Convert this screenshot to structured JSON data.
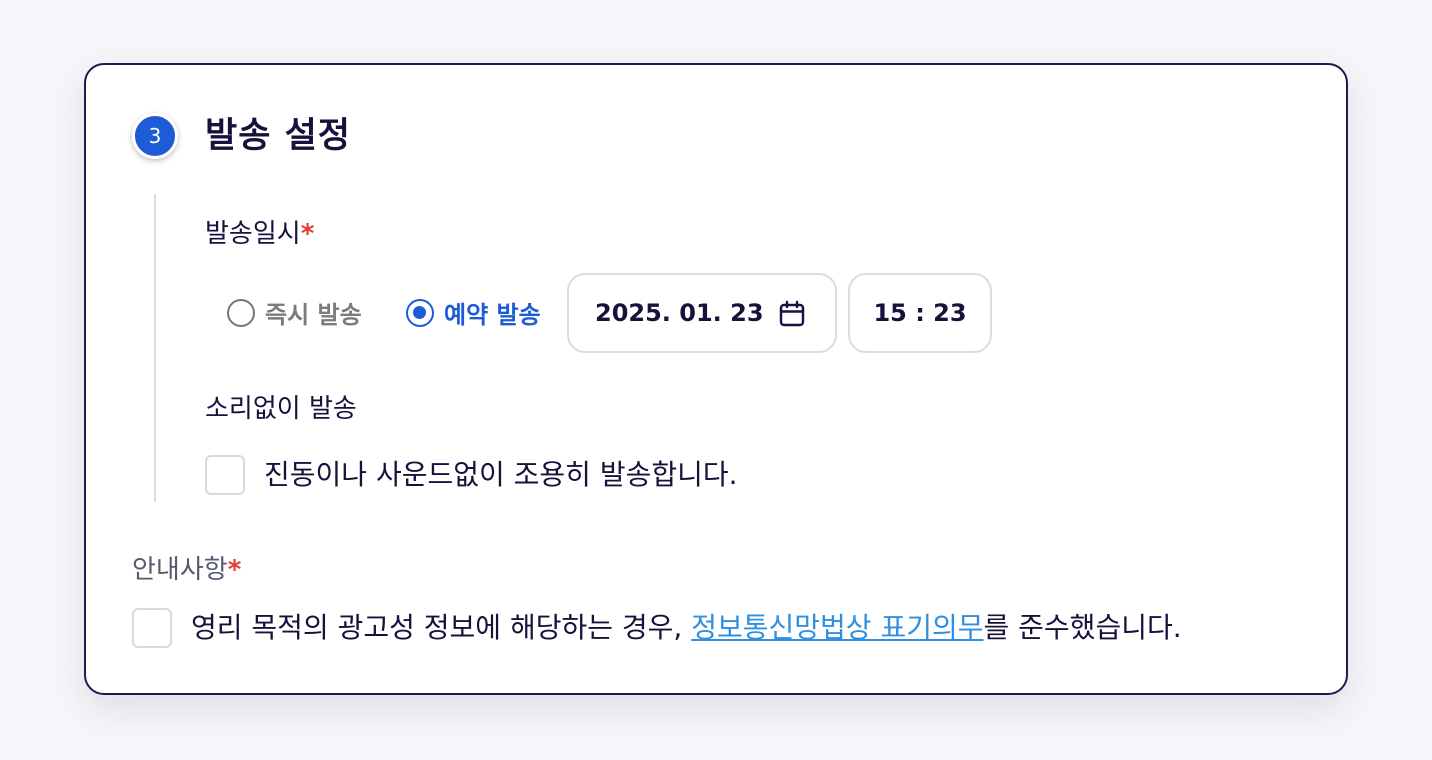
{
  "section": {
    "step_number": "3",
    "title": "발송 설정"
  },
  "send_datetime": {
    "label": "발송일시",
    "required_mark": "*",
    "options": [
      {
        "label": "즉시 발송",
        "selected": false
      },
      {
        "label": "예약 발송",
        "selected": true
      }
    ],
    "date_value": "2025. 01. 23",
    "time_value": "15 : 23"
  },
  "silent": {
    "label": "소리없이 발송",
    "checkbox_text": "진동이나 사운드없이 조용히 발송합니다.",
    "checked": false
  },
  "notice": {
    "label": "안내사항",
    "required_mark": "*",
    "text_before": "영리 목적의 광고성 정보에 해당하는 경우, ",
    "link_text": "정보통신망법상 표기의무",
    "text_after": "를 준수했습니다.",
    "checked": false
  },
  "colors": {
    "accent": "#1e5bd6",
    "title": "#15123b",
    "required": "#e53935",
    "link": "#2f8fe0",
    "border": "#1f1a4d"
  }
}
